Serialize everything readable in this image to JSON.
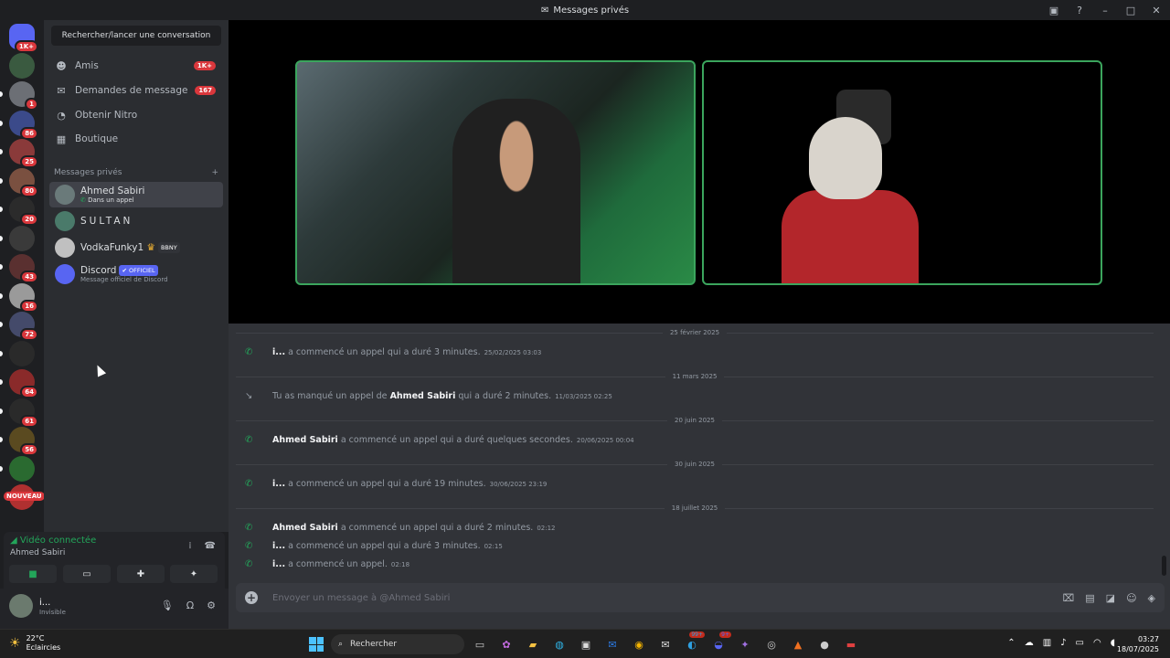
{
  "window": {
    "title": "Messages privés"
  },
  "servers": [
    {
      "badge": "1K+",
      "color": "#5865f2"
    },
    {
      "badge": "",
      "color": "#3a5a40"
    },
    {
      "badge": "1",
      "color": "#6c6f75"
    },
    {
      "badge": "86",
      "color": "#3b4a8a"
    },
    {
      "badge": "25",
      "color": "#8a3a3a"
    },
    {
      "badge": "80",
      "color": "#7a5040"
    },
    {
      "badge": "20",
      "color": "#2b2b2b"
    },
    {
      "badge": "",
      "color": "#3a3a3a"
    },
    {
      "badge": "43",
      "color": "#5a3030"
    },
    {
      "badge": "16",
      "color": "#9a9a9a"
    },
    {
      "badge": "72",
      "color": "#444a6a"
    },
    {
      "badge": "",
      "color": "#2a2a2a"
    },
    {
      "badge": "64",
      "color": "#8a2a2a"
    },
    {
      "badge": "61",
      "color": "#2a2a2a"
    },
    {
      "badge": "56",
      "color": "#5a4a20"
    },
    {
      "badge": "",
      "color": "#2a6a30"
    },
    {
      "badge": "",
      "color": "#b03030"
    }
  ],
  "nouveau_label": "NOUVEAU",
  "sidebar": {
    "search_label": "Rechercher/lancer une conversation",
    "nav": [
      {
        "label": "Amis",
        "count": "1K+"
      },
      {
        "label": "Demandes de message",
        "count": "167"
      },
      {
        "label": "Obtenir Nitro",
        "count": ""
      },
      {
        "label": "Boutique",
        "count": ""
      }
    ],
    "dm_header": "Messages privés",
    "dm_add": "+",
    "dms": [
      {
        "name": "Ahmed Sabiri",
        "sub": "Dans un appel",
        "color": "#6a7a7a"
      },
      {
        "name": "SULTAN",
        "sub": "",
        "color": "#4a7a6a"
      },
      {
        "name": "VodkaFunky1",
        "tag": "BBNY",
        "color": "#c0c0c0"
      },
      {
        "name": "Discord",
        "tag": "✔ OFFICIEL",
        "sub": "Message officiel de Discord",
        "color": "#5865f2"
      }
    ]
  },
  "voice": {
    "status": "Vidéo connectée",
    "channel": "Ahmed Sabiri"
  },
  "user": {
    "name": "i...",
    "status": "Invisible"
  },
  "chat": {
    "messages": [
      {
        "type": "divider",
        "text": "25 février 2025"
      },
      {
        "type": "call",
        "author": "i...",
        "text": "a commencé un appel qui a duré 3 minutes.",
        "ts": "25/02/2025 03:03"
      },
      {
        "type": "divider",
        "text": "11 mars 2025"
      },
      {
        "type": "missed",
        "prefix": "Tu as manqué un appel de",
        "author": "Ahmed Sabiri",
        "text": "qui a duré 2 minutes.",
        "ts": "11/03/2025 02:25"
      },
      {
        "type": "divider",
        "text": "20 juin 2025"
      },
      {
        "type": "call",
        "author": "Ahmed Sabiri",
        "text": "a commencé un appel qui a duré quelques secondes.",
        "ts": "20/06/2025 00:04"
      },
      {
        "type": "divider",
        "text": "30 juin 2025"
      },
      {
        "type": "call",
        "author": "i...",
        "text": "a commencé un appel qui a duré 19 minutes.",
        "ts": "30/06/2025 23:19"
      },
      {
        "type": "divider",
        "text": "18 juillet 2025"
      },
      {
        "type": "call",
        "author": "Ahmed Sabiri",
        "text": "a commencé un appel qui a duré 2 minutes.",
        "ts": "02:12"
      },
      {
        "type": "call",
        "author": "i...",
        "text": "a commencé un appel qui a duré 3 minutes.",
        "ts": "02:15"
      },
      {
        "type": "call",
        "author": "i...",
        "text": "a commencé un appel.",
        "ts": "02:18"
      }
    ],
    "composer_placeholder": "Envoyer un message à @Ahmed Sabiri"
  },
  "taskbar": {
    "temp": "22°C",
    "weather": "Eclaircies",
    "search": "Rechercher",
    "badge_99": "99+",
    "badge_9": "9+",
    "time": "03:27",
    "date": "18/07/2025"
  }
}
